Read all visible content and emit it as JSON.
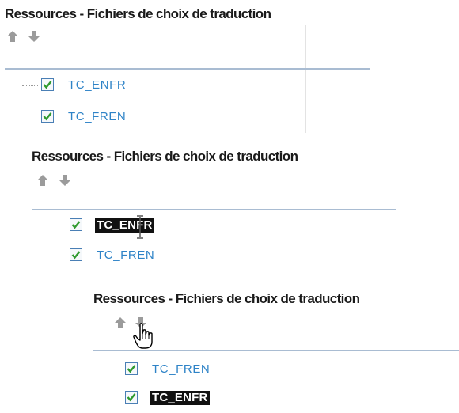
{
  "panels": [
    {
      "title": "Ressources - Fichiers de choix de traduction",
      "items": [
        {
          "label": "TC_ENFR",
          "checked": true,
          "selected": false
        },
        {
          "label": "TC_FREN",
          "checked": true,
          "selected": false
        }
      ]
    },
    {
      "title": "Ressources - Fichiers de choix de traduction",
      "items": [
        {
          "label": "TC_ENFR",
          "checked": true,
          "selected": true
        },
        {
          "label": "TC_FREN",
          "checked": true,
          "selected": false
        }
      ]
    },
    {
      "title": "Ressources - Fichiers de choix de traduction",
      "items": [
        {
          "label": "TC_FREN",
          "checked": true,
          "selected": false
        },
        {
          "label": "TC_ENFR",
          "checked": true,
          "selected": true
        }
      ]
    }
  ],
  "icons": {
    "move_up": "arrow-up-icon",
    "move_down": "arrow-down-icon",
    "checkbox_check": "check-icon",
    "text_cursor": "i-beam-cursor-icon",
    "hand_cursor": "hand-pointer-cursor-icon"
  },
  "colors": {
    "label": "#2e83c7",
    "selection_bg": "#111111",
    "selection_text": "#ffffff",
    "divider": "#a9bcd2",
    "checkbox_border": "#4a7fb5",
    "check": "#2f9a2f",
    "arrow": "#9b9b9b"
  }
}
